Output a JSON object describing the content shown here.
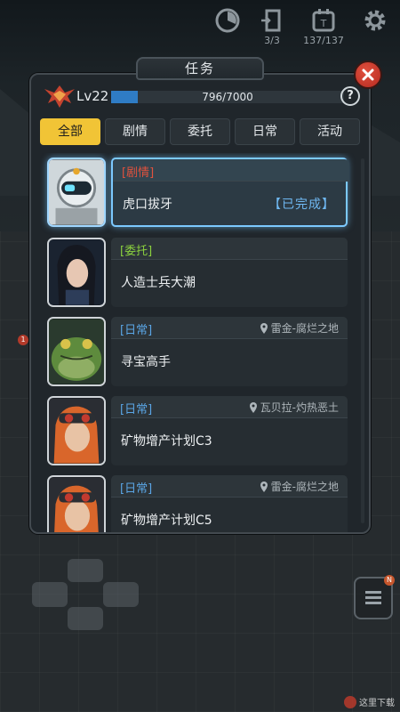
{
  "hud": {
    "cooldown_icon": "cooldown-icon",
    "door_count": "3/3",
    "energy_count": "137/137",
    "settings_icon": "gear-icon"
  },
  "panel": {
    "title": "任务",
    "level": "Lv22",
    "xp_text": "796/7000",
    "xp_fraction": 0.114,
    "help_label": "?"
  },
  "tabs": [
    {
      "label": "全部",
      "active": true
    },
    {
      "label": "剧情",
      "active": false
    },
    {
      "label": "委托",
      "active": false
    },
    {
      "label": "日常",
      "active": false
    },
    {
      "label": "活动",
      "active": false
    }
  ],
  "quests": [
    {
      "category": "[剧情]",
      "category_color": "#e0523e",
      "name": "虎口拔牙",
      "location": "",
      "status": "【已完成】",
      "portrait": "robot-portrait",
      "selected": true
    },
    {
      "category": "[委托]",
      "category_color": "#8bd13e",
      "name": "人造士兵大潮",
      "location": "",
      "status": "",
      "portrait": "woman-portrait",
      "selected": false
    },
    {
      "category": "[日常]",
      "category_color": "#5aa6e6",
      "name": "寻宝高手",
      "location": "雷金-腐烂之地",
      "status": "",
      "portrait": "toad-portrait",
      "selected": false
    },
    {
      "category": "[日常]",
      "category_color": "#5aa6e6",
      "name": "矿物增产计划C3",
      "location": "瓦贝拉-灼热恶土",
      "status": "",
      "portrait": "goggles-girl-portrait",
      "selected": false
    },
    {
      "category": "[日常]",
      "category_color": "#5aa6e6",
      "name": "矿物增产计划C5",
      "location": "雷金-腐烂之地",
      "status": "",
      "portrait": "goggles-girl-portrait",
      "selected": false
    }
  ],
  "background": {
    "left_badge": "1",
    "side_badge": "N"
  },
  "watermark": "这里下载"
}
